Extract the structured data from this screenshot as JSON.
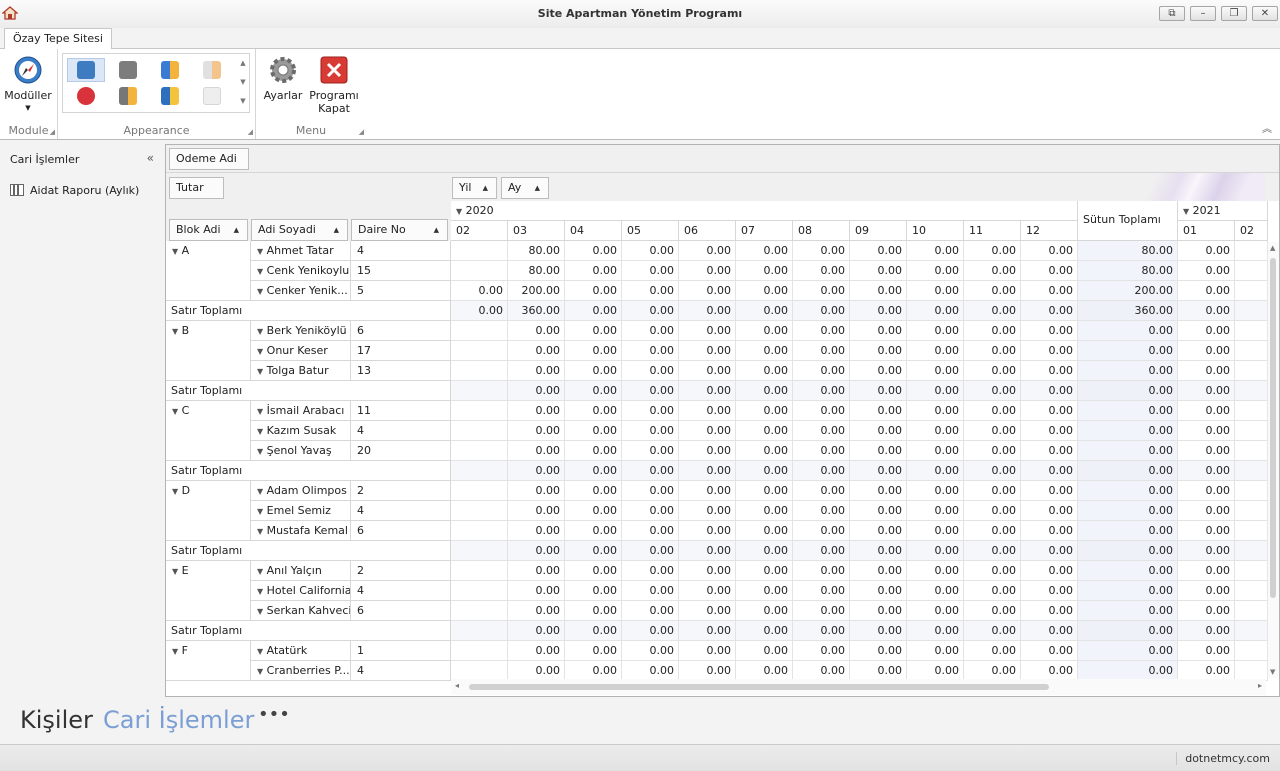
{
  "window": {
    "title": "Site Apartman Yönetim Programı"
  },
  "ribbon": {
    "tab": "Özay Tepe Sitesi",
    "module_group": {
      "label": "Module",
      "button": "Modüller"
    },
    "appearance_group": {
      "label": "Appearance"
    },
    "menu_group": {
      "label": "Menu",
      "settings": "Ayarlar",
      "close_line1": "Programı",
      "close_line2": "Kapat"
    }
  },
  "nav": {
    "header": "Cari İşlemler",
    "item": "Aidat Raporu (Aylık)"
  },
  "pivot": {
    "filter_field": "Odeme Adi",
    "data_field": "Tutar",
    "col_fields": [
      "Yil",
      "Ay"
    ],
    "row_fields": [
      "Blok Adi",
      "Adi Soyadi",
      "Daire No"
    ],
    "year_2020": "2020",
    "year_2021": "2021",
    "grand_total_label": "Sütun Toplamı",
    "months_2020": [
      "02",
      "03",
      "04",
      "05",
      "06",
      "07",
      "08",
      "09",
      "10",
      "11",
      "12"
    ],
    "months_2021": [
      "01",
      "02"
    ],
    "subtotal_label": "Satır Toplamı",
    "rows": [
      {
        "block": "A",
        "name": "Ahmet Tatar",
        "no": "4",
        "v": [
          "",
          "80.00",
          "0.00",
          "0.00",
          "0.00",
          "0.00",
          "0.00",
          "0.00",
          "0.00",
          "0.00",
          "0.00"
        ],
        "t": "80.00",
        "n": [
          "0.00",
          ""
        ]
      },
      {
        "name": "Cenk Yenikoylu",
        "no": "15",
        "v": [
          "",
          "80.00",
          "0.00",
          "0.00",
          "0.00",
          "0.00",
          "0.00",
          "0.00",
          "0.00",
          "0.00",
          "0.00"
        ],
        "t": "80.00",
        "n": [
          "0.00",
          ""
        ]
      },
      {
        "name": "Cenker Yenik...",
        "no": "5",
        "v": [
          "0.00",
          "200.00",
          "0.00",
          "0.00",
          "0.00",
          "0.00",
          "0.00",
          "0.00",
          "0.00",
          "0.00",
          "0.00"
        ],
        "t": "200.00",
        "n": [
          "0.00",
          ""
        ]
      },
      {
        "sub": true,
        "v": [
          "0.00",
          "360.00",
          "0.00",
          "0.00",
          "0.00",
          "0.00",
          "0.00",
          "0.00",
          "0.00",
          "0.00",
          "0.00"
        ],
        "t": "360.00",
        "n": [
          "0.00",
          ""
        ]
      },
      {
        "block": "B",
        "name": "Berk Yeniköylü",
        "no": "6",
        "v": [
          "",
          "0.00",
          "0.00",
          "0.00",
          "0.00",
          "0.00",
          "0.00",
          "0.00",
          "0.00",
          "0.00",
          "0.00"
        ],
        "t": "0.00",
        "n": [
          "0.00",
          ""
        ]
      },
      {
        "name": "Onur Keser",
        "no": "17",
        "v": [
          "",
          "0.00",
          "0.00",
          "0.00",
          "0.00",
          "0.00",
          "0.00",
          "0.00",
          "0.00",
          "0.00",
          "0.00"
        ],
        "t": "0.00",
        "n": [
          "0.00",
          ""
        ]
      },
      {
        "name": "Tolga Batur",
        "no": "13",
        "v": [
          "",
          "0.00",
          "0.00",
          "0.00",
          "0.00",
          "0.00",
          "0.00",
          "0.00",
          "0.00",
          "0.00",
          "0.00"
        ],
        "t": "0.00",
        "n": [
          "0.00",
          ""
        ]
      },
      {
        "sub": true,
        "v": [
          "",
          "0.00",
          "0.00",
          "0.00",
          "0.00",
          "0.00",
          "0.00",
          "0.00",
          "0.00",
          "0.00",
          "0.00"
        ],
        "t": "0.00",
        "n": [
          "0.00",
          ""
        ]
      },
      {
        "block": "C",
        "name": "İsmail Arabacı",
        "no": "11",
        "v": [
          "",
          "0.00",
          "0.00",
          "0.00",
          "0.00",
          "0.00",
          "0.00",
          "0.00",
          "0.00",
          "0.00",
          "0.00"
        ],
        "t": "0.00",
        "n": [
          "0.00",
          ""
        ]
      },
      {
        "name": "Kazım Susak",
        "no": "4",
        "v": [
          "",
          "0.00",
          "0.00",
          "0.00",
          "0.00",
          "0.00",
          "0.00",
          "0.00",
          "0.00",
          "0.00",
          "0.00"
        ],
        "t": "0.00",
        "n": [
          "0.00",
          ""
        ]
      },
      {
        "name": "Şenol Yavaş",
        "no": "20",
        "v": [
          "",
          "0.00",
          "0.00",
          "0.00",
          "0.00",
          "0.00",
          "0.00",
          "0.00",
          "0.00",
          "0.00",
          "0.00"
        ],
        "t": "0.00",
        "n": [
          "0.00",
          ""
        ]
      },
      {
        "sub": true,
        "v": [
          "",
          "0.00",
          "0.00",
          "0.00",
          "0.00",
          "0.00",
          "0.00",
          "0.00",
          "0.00",
          "0.00",
          "0.00"
        ],
        "t": "0.00",
        "n": [
          "0.00",
          ""
        ]
      },
      {
        "block": "D",
        "name": "Adam Olimpos",
        "no": "2",
        "v": [
          "",
          "0.00",
          "0.00",
          "0.00",
          "0.00",
          "0.00",
          "0.00",
          "0.00",
          "0.00",
          "0.00",
          "0.00"
        ],
        "t": "0.00",
        "n": [
          "0.00",
          ""
        ]
      },
      {
        "name": "Emel Semiz",
        "no": "4",
        "v": [
          "",
          "0.00",
          "0.00",
          "0.00",
          "0.00",
          "0.00",
          "0.00",
          "0.00",
          "0.00",
          "0.00",
          "0.00"
        ],
        "t": "0.00",
        "n": [
          "0.00",
          ""
        ]
      },
      {
        "name": "Mustafa Kemal",
        "no": "6",
        "v": [
          "",
          "0.00",
          "0.00",
          "0.00",
          "0.00",
          "0.00",
          "0.00",
          "0.00",
          "0.00",
          "0.00",
          "0.00"
        ],
        "t": "0.00",
        "n": [
          "0.00",
          ""
        ]
      },
      {
        "sub": true,
        "v": [
          "",
          "0.00",
          "0.00",
          "0.00",
          "0.00",
          "0.00",
          "0.00",
          "0.00",
          "0.00",
          "0.00",
          "0.00"
        ],
        "t": "0.00",
        "n": [
          "0.00",
          ""
        ]
      },
      {
        "block": "E",
        "name": "Anıl Yalçın",
        "no": "2",
        "v": [
          "",
          "0.00",
          "0.00",
          "0.00",
          "0.00",
          "0.00",
          "0.00",
          "0.00",
          "0.00",
          "0.00",
          "0.00"
        ],
        "t": "0.00",
        "n": [
          "0.00",
          ""
        ]
      },
      {
        "name": "Hotel California",
        "no": "4",
        "v": [
          "",
          "0.00",
          "0.00",
          "0.00",
          "0.00",
          "0.00",
          "0.00",
          "0.00",
          "0.00",
          "0.00",
          "0.00"
        ],
        "t": "0.00",
        "n": [
          "0.00",
          ""
        ]
      },
      {
        "name": "Serkan Kahveci",
        "no": "6",
        "v": [
          "",
          "0.00",
          "0.00",
          "0.00",
          "0.00",
          "0.00",
          "0.00",
          "0.00",
          "0.00",
          "0.00",
          "0.00"
        ],
        "t": "0.00",
        "n": [
          "0.00",
          ""
        ]
      },
      {
        "sub": true,
        "v": [
          "",
          "0.00",
          "0.00",
          "0.00",
          "0.00",
          "0.00",
          "0.00",
          "0.00",
          "0.00",
          "0.00",
          "0.00"
        ],
        "t": "0.00",
        "n": [
          "0.00",
          ""
        ]
      },
      {
        "block": "F",
        "name": "Atatürk",
        "no": "1",
        "v": [
          "",
          "0.00",
          "0.00",
          "0.00",
          "0.00",
          "0.00",
          "0.00",
          "0.00",
          "0.00",
          "0.00",
          "0.00"
        ],
        "t": "0.00",
        "n": [
          "0.00",
          ""
        ]
      },
      {
        "name": "Cranberries P...",
        "no": "4",
        "v": [
          "",
          "0.00",
          "0.00",
          "0.00",
          "0.00",
          "0.00",
          "0.00",
          "0.00",
          "0.00",
          "0.00",
          "0.00"
        ],
        "t": "0.00",
        "n": [
          "0.00",
          ""
        ]
      }
    ]
  },
  "bottom_nav": {
    "items": [
      "Kişiler",
      "Cari İşlemler"
    ],
    "more": "•••",
    "accent": "#7b9fd4"
  },
  "status": {
    "right": "dotnetmcy.com"
  }
}
